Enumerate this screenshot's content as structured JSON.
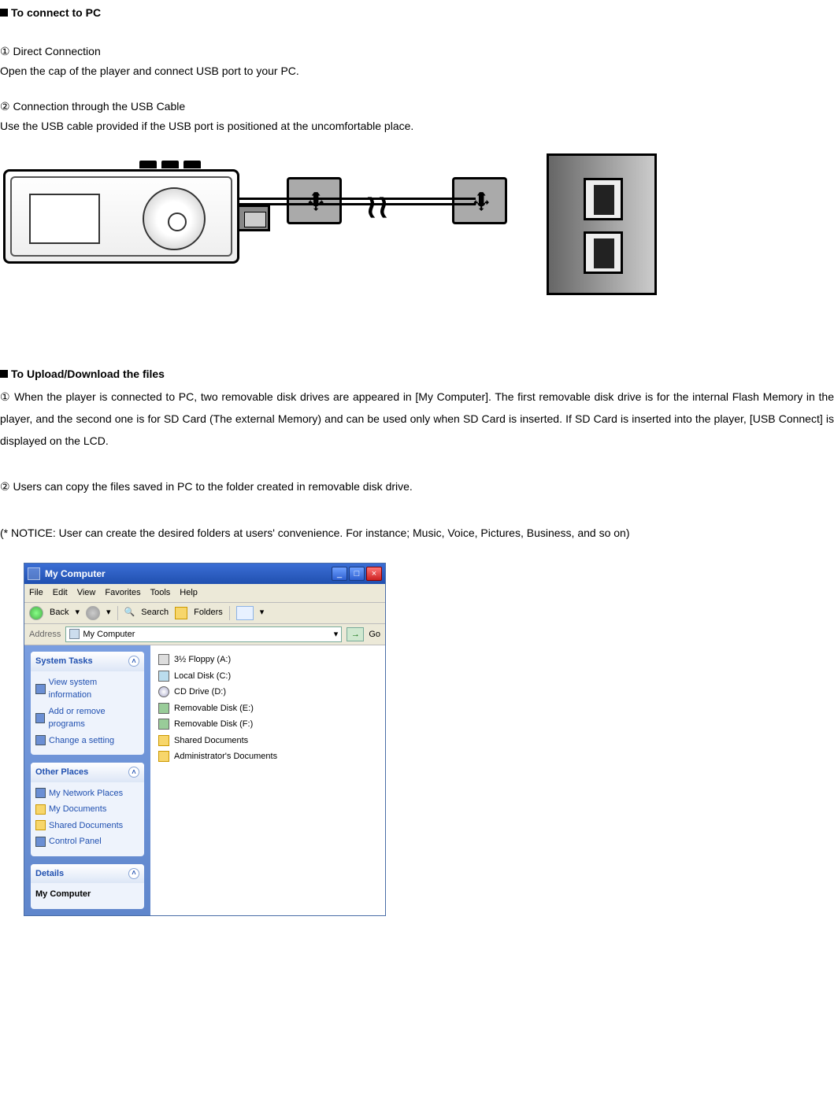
{
  "sec1": {
    "heading": "To connect to PC",
    "item1_marker": "①",
    "item1_title": "Direct Connection",
    "item1_text": "Open the cap of the player and connect USB port to your PC.",
    "item2_marker": "②",
    "item2_title": "Connection through the USB Cable",
    "item2_text": "Use the USB cable provided if the USB port is positioned at the uncomfortable place."
  },
  "sec2": {
    "heading": "To Upload/Download the files",
    "item1_marker": "①",
    "item1_text": "When the player is connected to PC, two removable disk drives are appeared in [My Computer].  The first removable disk drive is for the internal Flash Memory in the player, and the second one is for SD Card (The external Memory) and can be used only when SD Card is inserted.  If SD Card is inserted into the player, [USB Connect] is displayed on the LCD.",
    "item2_marker": "②",
    "item2_text": "Users can copy the files saved in PC to the folder created in removable disk drive.",
    "notice": "(* NOTICE: User can create the desired folders at users' convenience.  For instance; Music, Voice, Pictures, Business, and so on)"
  },
  "win": {
    "title": "My Computer",
    "menu": {
      "file": "File",
      "edit": "Edit",
      "view": "View",
      "favorites": "Favorites",
      "tools": "Tools",
      "help": "Help"
    },
    "toolbar": {
      "back": "Back",
      "search": "Search",
      "folders": "Folders"
    },
    "addr": {
      "label": "Address",
      "value": "My Computer",
      "go": "Go"
    },
    "tasks": {
      "heading": "System Tasks",
      "items": [
        "View system information",
        "Add or remove programs",
        "Change a setting"
      ]
    },
    "places": {
      "heading": "Other Places",
      "items": [
        "My Network Places",
        "My Documents",
        "Shared Documents",
        "Control Panel"
      ]
    },
    "details": {
      "heading": "Details",
      "text": "My Computer"
    },
    "drives": [
      "3½ Floppy (A:)",
      "Local Disk (C:)",
      "CD Drive (D:)",
      "Removable Disk (E:)",
      "Removable Disk (F:)",
      "Shared Documents",
      "Administrator's Documents"
    ]
  }
}
